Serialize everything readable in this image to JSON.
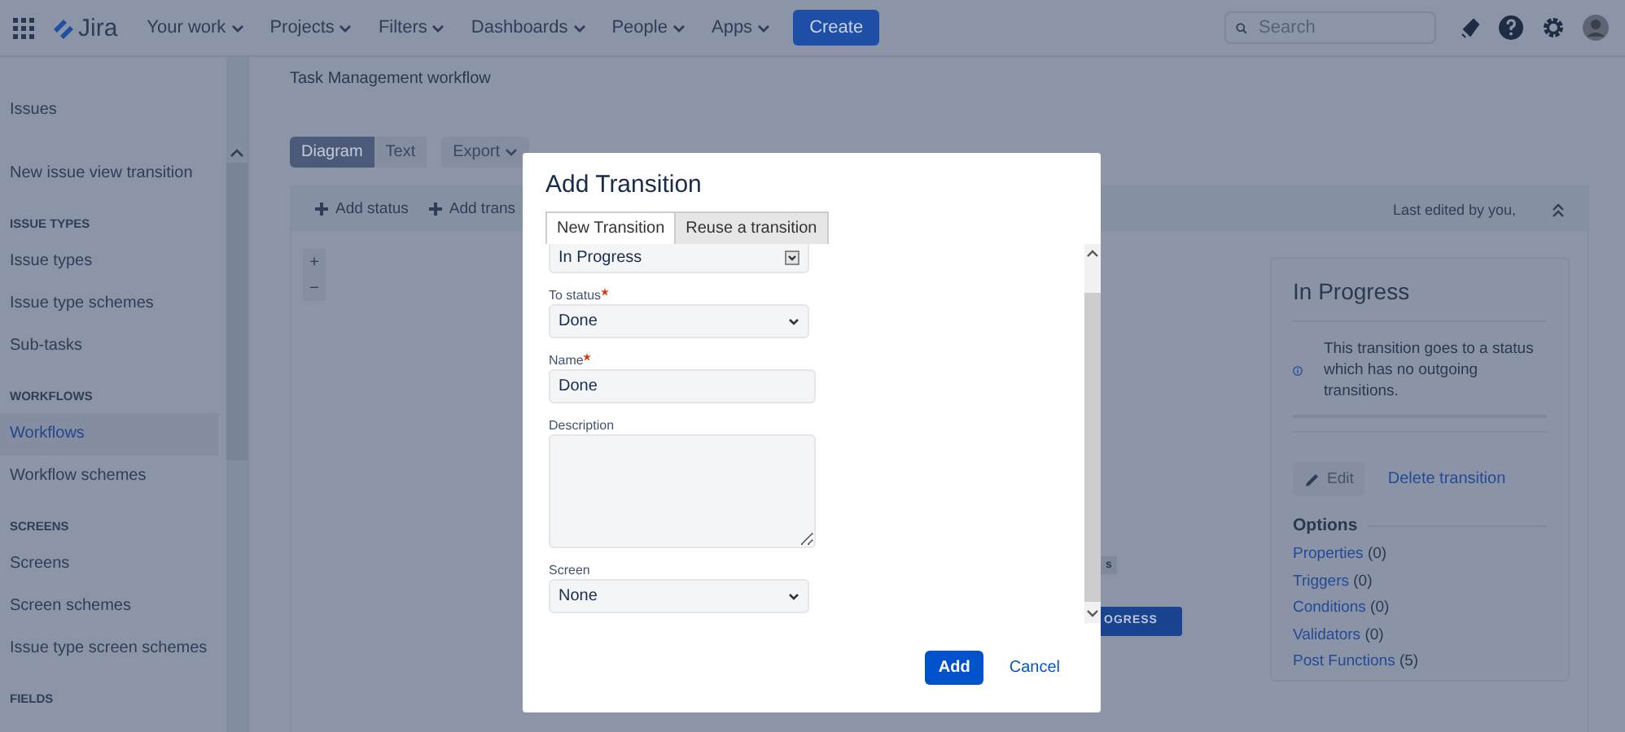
{
  "topbar": {
    "logo": "Jira",
    "nav": [
      {
        "label": "Your work"
      },
      {
        "label": "Projects"
      },
      {
        "label": "Filters"
      },
      {
        "label": "Dashboards"
      },
      {
        "label": "People"
      },
      {
        "label": "Apps"
      }
    ],
    "create": "Create",
    "search": {
      "placeholder": "Search"
    }
  },
  "sidebar": {
    "items": [
      {
        "kind": "title",
        "label": "Issues",
        "selected": false
      },
      {
        "kind": "link",
        "label": "New issue view transition",
        "selected": false
      },
      {
        "kind": "heading",
        "label": "ISSUE TYPES"
      },
      {
        "kind": "link",
        "label": "Issue types",
        "selected": false
      },
      {
        "kind": "link",
        "label": "Issue type schemes",
        "selected": false
      },
      {
        "kind": "link",
        "label": "Sub-tasks",
        "selected": false
      },
      {
        "kind": "heading",
        "label": "WORKFLOWS"
      },
      {
        "kind": "link",
        "label": "Workflows",
        "selected": true
      },
      {
        "kind": "link",
        "label": "Workflow schemes",
        "selected": false
      },
      {
        "kind": "heading",
        "label": "SCREENS"
      },
      {
        "kind": "link",
        "label": "Screens",
        "selected": false
      },
      {
        "kind": "link",
        "label": "Screen schemes",
        "selected": false
      },
      {
        "kind": "link",
        "label": "Issue type screen schemes",
        "selected": false
      },
      {
        "kind": "heading",
        "label": "FIELDS"
      }
    ]
  },
  "main": {
    "title": "Task Management workflow",
    "view_tabs": [
      {
        "label": "Diagram",
        "selected": true
      },
      {
        "label": "Text",
        "selected": false
      }
    ],
    "export": "Export",
    "toolbar": {
      "add_status": "Add status",
      "add_transition": "Add trans",
      "last_edited": "Last edited by you,"
    },
    "diagram": {
      "zoom_in": "+",
      "zoom_out": "−",
      "status_tag": "s",
      "status_node": "OGRESS"
    },
    "details": {
      "title": "In Progress",
      "info": "This transition goes to a status which has no outgoing transitions.",
      "edit": "Edit",
      "delete": "Delete transition",
      "options_heading": "Options",
      "options": [
        {
          "label": "Properties",
          "count": "(0)"
        },
        {
          "label": "Triggers",
          "count": "(0)"
        },
        {
          "label": "Conditions",
          "count": "(0)"
        },
        {
          "label": "Validators",
          "count": "(0)"
        },
        {
          "label": "Post Functions",
          "count": "(5)"
        }
      ]
    }
  },
  "modal": {
    "title": "Add Transition",
    "tabs": [
      {
        "label": "New Transition",
        "selected": true
      },
      {
        "label": "Reuse a transition",
        "selected": false
      }
    ],
    "fields": [
      {
        "kind": "picker",
        "value": "In Progress"
      },
      {
        "kind": "select",
        "label": "To status",
        "required": true,
        "value": "Done"
      },
      {
        "kind": "text",
        "label": "Name",
        "required": true,
        "value": "Done"
      },
      {
        "kind": "textarea",
        "label": "Description"
      },
      {
        "kind": "select",
        "label": "Screen",
        "value": "None"
      }
    ],
    "add": "Add",
    "cancel": "Cancel"
  }
}
